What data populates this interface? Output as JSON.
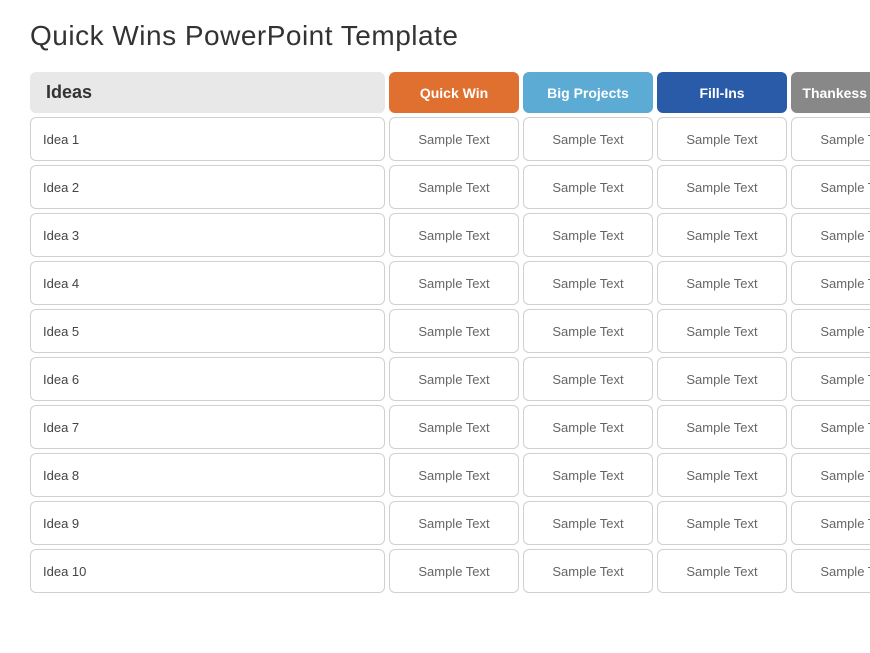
{
  "title": "Quick Wins PowerPoint Template",
  "headers": {
    "ideas": "Ideas",
    "quick_win": "Quick Win",
    "big_projects": "Big Projects",
    "fill_ins": "Fill-Ins",
    "thankless_tasks": "Thankess Tasks"
  },
  "colors": {
    "ideas_bg": "#e8e8e8",
    "quick_win_bg": "#e07030",
    "big_projects_bg": "#5babd4",
    "fill_ins_bg": "#2a5ba8",
    "thankless_bg": "#888888"
  },
  "rows": [
    {
      "idea": "Idea 1",
      "qw": "Sample Text",
      "bp": "Sample Text",
      "fi": "Sample Text",
      "tt": "Sample Text"
    },
    {
      "idea": "Idea 2",
      "qw": "Sample Text",
      "bp": "Sample Text",
      "fi": "Sample Text",
      "tt": "Sample Text"
    },
    {
      "idea": "Idea 3",
      "qw": "Sample Text",
      "bp": "Sample Text",
      "fi": "Sample Text",
      "tt": "Sample Text"
    },
    {
      "idea": "Idea 4",
      "qw": "Sample Text",
      "bp": "Sample Text",
      "fi": "Sample Text",
      "tt": "Sample Text"
    },
    {
      "idea": "Idea 5",
      "qw": "Sample Text",
      "bp": "Sample Text",
      "fi": "Sample Text",
      "tt": "Sample Text"
    },
    {
      "idea": "Idea 6",
      "qw": "Sample Text",
      "bp": "Sample Text",
      "fi": "Sample Text",
      "tt": "Sample Text"
    },
    {
      "idea": "Idea 7",
      "qw": "Sample Text",
      "bp": "Sample Text",
      "fi": "Sample Text",
      "tt": "Sample Text"
    },
    {
      "idea": "Idea 8",
      "qw": "Sample Text",
      "bp": "Sample Text",
      "fi": "Sample Text",
      "tt": "Sample Text"
    },
    {
      "idea": "Idea 9",
      "qw": "Sample Text",
      "bp": "Sample Text",
      "fi": "Sample Text",
      "tt": "Sample Text"
    },
    {
      "idea": "Idea 10",
      "qw": "Sample Text",
      "bp": "Sample Text",
      "fi": "Sample Text",
      "tt": "Sample Text"
    }
  ]
}
